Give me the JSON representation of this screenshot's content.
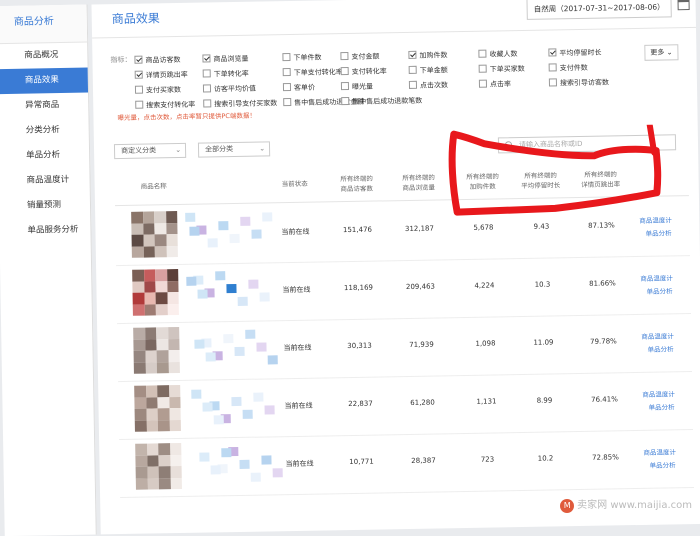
{
  "sidebar": {
    "heading": "商品分析",
    "items": [
      {
        "label": "商品概况",
        "active": false
      },
      {
        "label": "商品效果",
        "active": true
      },
      {
        "label": "异常商品",
        "active": false
      },
      {
        "label": "分类分析",
        "active": false
      },
      {
        "label": "单品分析",
        "active": false
      },
      {
        "label": "商品温度计",
        "active": false
      },
      {
        "label": "销量预测",
        "active": false
      },
      {
        "label": "单品服务分析",
        "active": false
      }
    ]
  },
  "header": {
    "title": "商品效果",
    "date_range": "自然周（2017-07-31~2017-08-06）"
  },
  "metrics": {
    "label": "指标：",
    "more_label": "更多",
    "items": [
      {
        "label": "商品访客数",
        "checked": true
      },
      {
        "label": "商品浏览量",
        "checked": true
      },
      {
        "label": "下单件数",
        "checked": false
      },
      {
        "label": "支付金额",
        "checked": false
      },
      {
        "label": "加购件数",
        "checked": true
      },
      {
        "label": "收藏人数",
        "checked": false
      },
      {
        "label": "平均停留时长",
        "checked": true
      },
      {
        "label": "详情页跳出率",
        "checked": true
      },
      {
        "label": "下单转化率",
        "checked": false
      },
      {
        "label": "下单支付转化率",
        "checked": false
      },
      {
        "label": "支付转化率",
        "checked": false
      },
      {
        "label": "下单金额",
        "checked": false
      },
      {
        "label": "下单买家数",
        "checked": false
      },
      {
        "label": "支付件数",
        "checked": false
      },
      {
        "label": "支付买家数",
        "checked": false
      },
      {
        "label": "访客平均价值",
        "checked": false
      },
      {
        "label": "客单价",
        "checked": false
      },
      {
        "label": "曝光量",
        "checked": false
      },
      {
        "label": "点击次数",
        "checked": false
      },
      {
        "label": "点击率",
        "checked": false
      },
      {
        "label": "搜索引导访客数",
        "checked": false
      },
      {
        "label": "搜索支付转化率",
        "checked": false
      },
      {
        "label": "搜索引导支付买家数",
        "checked": false
      },
      {
        "label": "售中售后成功退款金额",
        "checked": false
      },
      {
        "label": "售中售后成功退款笔数",
        "checked": false
      }
    ]
  },
  "note": "曝光量，点击次数，点击率暂只提供PC端数据！",
  "filters": {
    "custom_category": "商定义分类",
    "all_category": "全部分类",
    "search_placeholder": "请输入商品名称或ID"
  },
  "table": {
    "headers": {
      "product": "商品名称",
      "status": "当前状态",
      "visitors": "所有终端的\n商品访客数",
      "views": "所有终端的\n商品浏览量",
      "cart": "所有终端的\n加购件数",
      "stay": "所有终端的\n平均停留时长",
      "bounce": "所有终端的\n详情页跳出率"
    },
    "rows": [
      {
        "status": "当前在线",
        "visitors": "151,476",
        "views": "312,187",
        "cart": "5,678",
        "stay": "9.43",
        "bounce": "87.13%",
        "link1": "商品温度计",
        "link2": "单品分析"
      },
      {
        "status": "当前在线",
        "visitors": "118,169",
        "views": "209,463",
        "cart": "4,224",
        "stay": "10.3",
        "bounce": "81.66%",
        "link1": "商品温度计",
        "link2": "单品分析"
      },
      {
        "status": "当前在线",
        "visitors": "30,313",
        "views": "71,939",
        "cart": "1,098",
        "stay": "11.09",
        "bounce": "79.78%",
        "link1": "商品温度计",
        "link2": "单品分析"
      },
      {
        "status": "当前在线",
        "visitors": "22,837",
        "views": "61,280",
        "cart": "1,131",
        "stay": "8.99",
        "bounce": "76.41%",
        "link1": "商品温度计",
        "link2": "单品分析"
      },
      {
        "status": "当前在线",
        "visitors": "10,771",
        "views": "28,387",
        "cart": "723",
        "stay": "10.2",
        "bounce": "72.85%",
        "link1": "商品温度计",
        "link2": "单品分析"
      }
    ]
  },
  "watermark": "卖家网 www.maijia.com",
  "colors": {
    "accent": "#3a7bd5",
    "annotation": "#e8181c",
    "note": "#e05b3c"
  }
}
